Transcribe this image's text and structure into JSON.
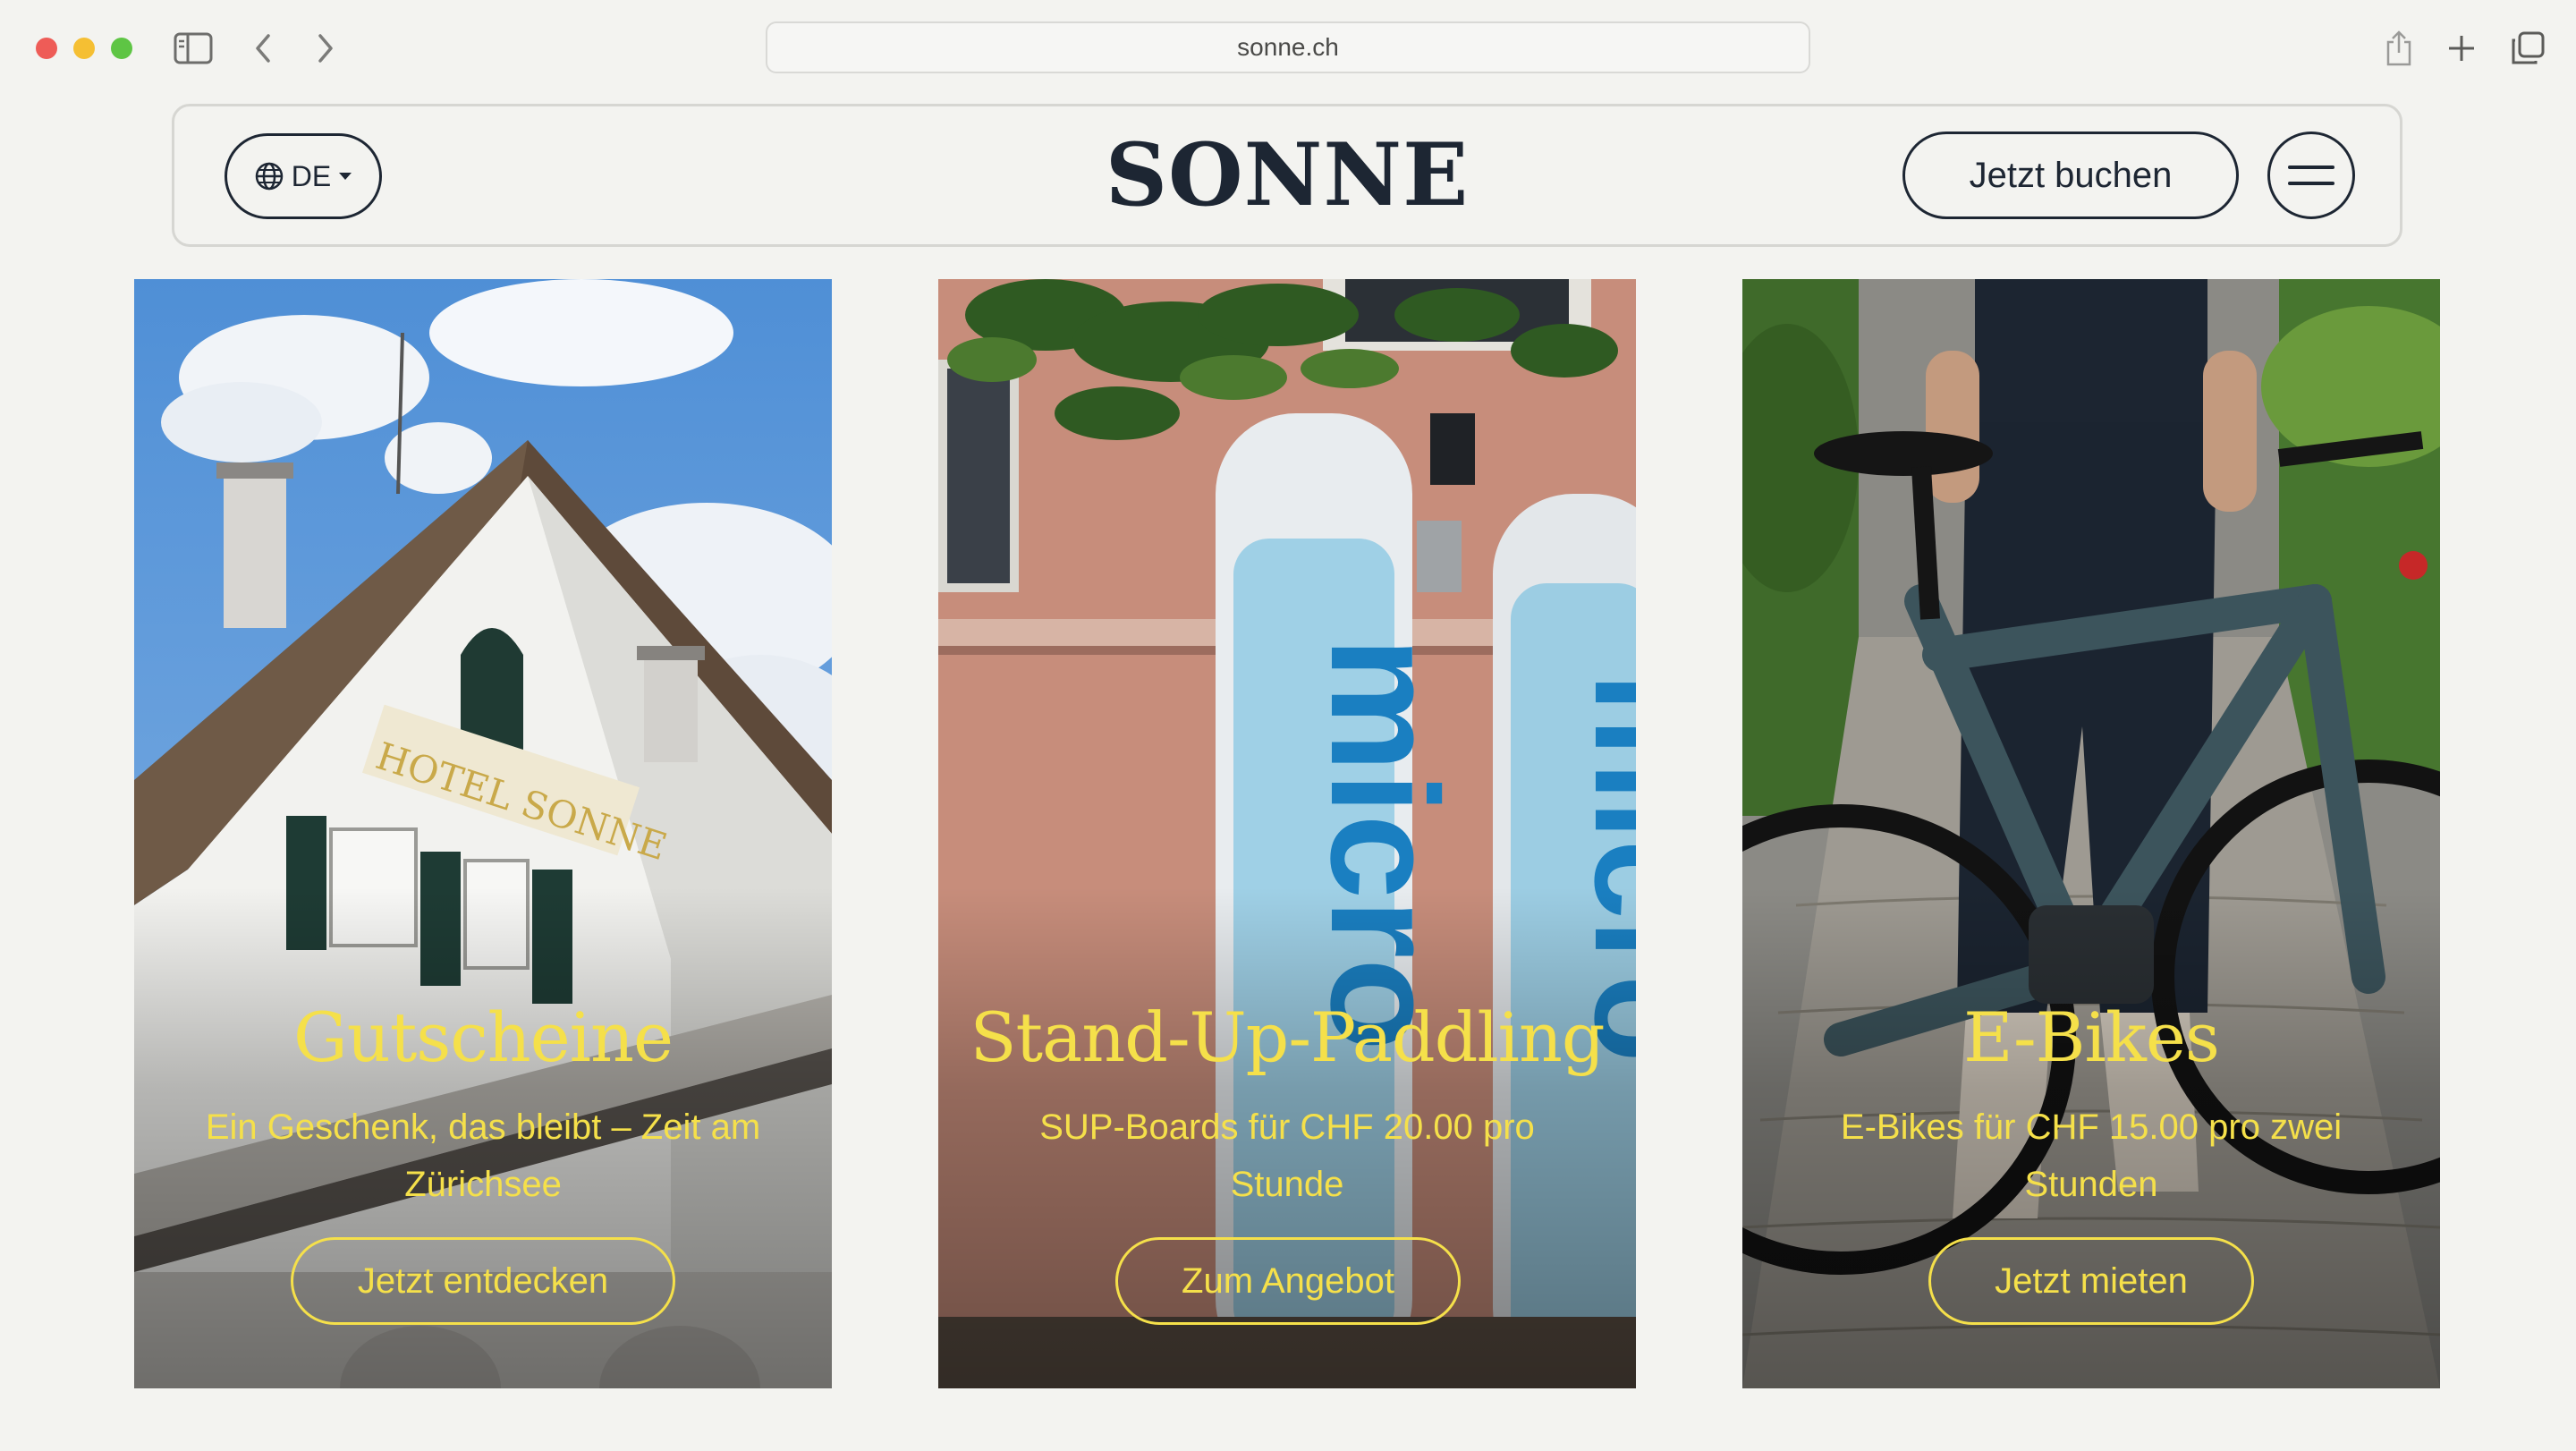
{
  "browser": {
    "url": "sonne.ch",
    "icons": [
      "sidebar-icon",
      "back-icon",
      "forward-icon",
      "share-icon",
      "new-tab-icon",
      "tabs-overview-icon"
    ]
  },
  "header": {
    "language": "DE",
    "logo": "SONNE",
    "book_label": "Jetzt buchen"
  },
  "cards": [
    {
      "title": "Gutscheine",
      "subtitle": "Ein Geschenk, das bleibt – Zeit am Zürichsee",
      "button": "Jetzt entdecken",
      "image_text": "HOTEL SONNE"
    },
    {
      "title": "Stand-Up-Paddling",
      "subtitle": "SUP-Boards für CHF 20.00 pro Stunde",
      "button": "Zum Angebot",
      "image_text": "micro"
    },
    {
      "title": "E-Bikes",
      "subtitle": "E-Bikes für CHF 15.00 pro zwei Stunden",
      "button": "Jetzt mieten"
    }
  ],
  "colors": {
    "accent_yellow": "#f5e04a",
    "navy": "#1d2633",
    "background": "#f3f3f0"
  }
}
